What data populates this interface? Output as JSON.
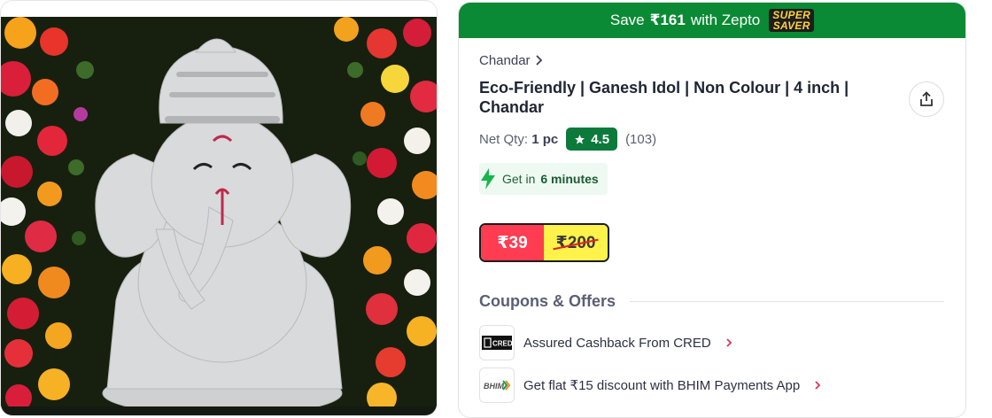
{
  "product_image": {
    "alt": "Ganesh idol"
  },
  "banner": {
    "prefix": "Save",
    "amount": "₹161",
    "suffix": "with Zepto",
    "badge_line1": "SUPER",
    "badge_line2": "SAVER",
    "color": "#0a8a34"
  },
  "brand": {
    "name": "Chandar"
  },
  "product": {
    "title": "Eco-Friendly | Ganesh Idol | Non Colour | 4 inch | Chandar",
    "net_qty_label": "Net Qty:",
    "net_qty_value": "1 pc",
    "rating": "4.5",
    "rating_count": "(103)"
  },
  "delivery": {
    "prefix": "Get in",
    "time": "6 minutes"
  },
  "price": {
    "current": "₹39",
    "mrp": "₹200",
    "current_color": "#ff3c52",
    "mrp_bg": "#fff24a"
  },
  "coupons": {
    "heading": "Coupons & Offers",
    "items": [
      {
        "logo": "CRED",
        "text": "Assured Cashback From CRED"
      },
      {
        "logo": "BHIM",
        "text": "Get flat ₹15 discount with BHIM Payments App"
      }
    ]
  }
}
